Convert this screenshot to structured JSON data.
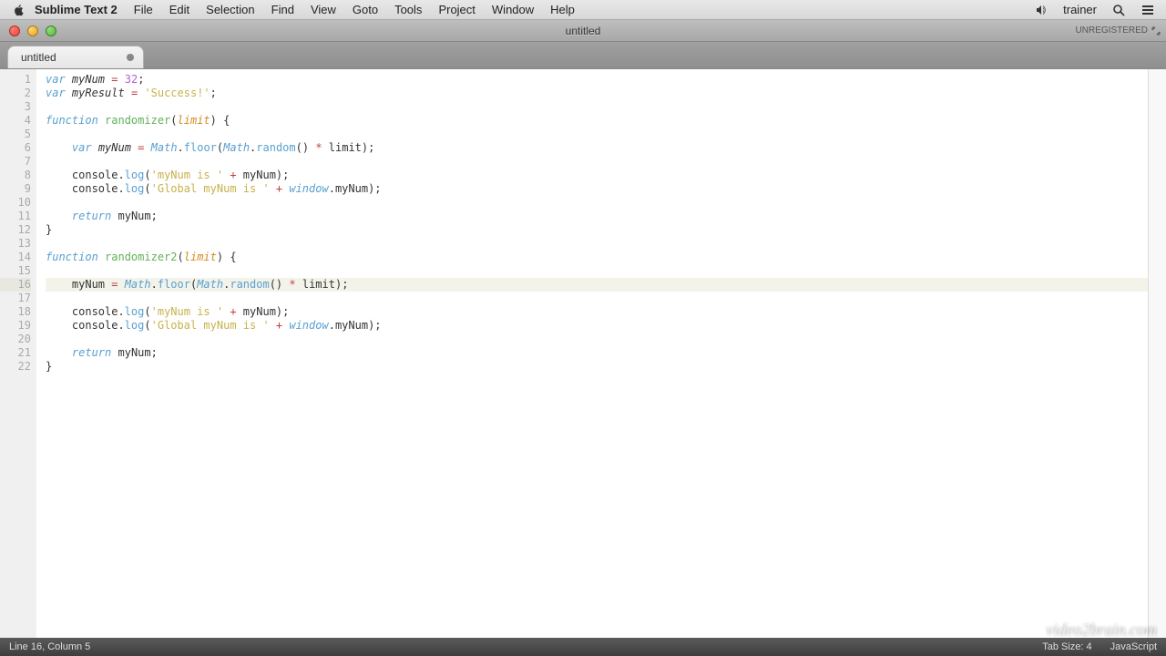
{
  "menubar": {
    "app_name": "Sublime Text 2",
    "items": [
      "File",
      "Edit",
      "Selection",
      "Find",
      "View",
      "Goto",
      "Tools",
      "Project",
      "Window",
      "Help"
    ],
    "user": "trainer"
  },
  "window": {
    "title": "untitled",
    "badge": "UNREGISTERED"
  },
  "tabs": [
    {
      "label": "untitled",
      "dirty": true
    }
  ],
  "editor": {
    "highlighted_line": 16,
    "line_count": 22,
    "code_tokens": [
      [
        [
          "kw",
          "var"
        ],
        [
          "decl",
          " myNum"
        ],
        [
          "op",
          " = "
        ],
        [
          "num",
          "32"
        ],
        [
          "punc",
          ";"
        ]
      ],
      [
        [
          "kw",
          "var"
        ],
        [
          "decl",
          " myResult"
        ],
        [
          "op",
          " = "
        ],
        [
          "str",
          "'Success!'"
        ],
        [
          "punc",
          ";"
        ]
      ],
      [],
      [
        [
          "kw",
          "function"
        ],
        [
          "punc",
          " "
        ],
        [
          "fname",
          "randomizer"
        ],
        [
          "punc",
          "("
        ],
        [
          "param",
          "limit"
        ],
        [
          "punc",
          ") {"
        ]
      ],
      [],
      [
        [
          "punc",
          "    "
        ],
        [
          "kw",
          "var"
        ],
        [
          "decl",
          " myNum"
        ],
        [
          "op",
          " = "
        ],
        [
          "cls",
          "Math"
        ],
        [
          "punc",
          "."
        ],
        [
          "method",
          "floor"
        ],
        [
          "punc",
          "("
        ],
        [
          "cls",
          "Math"
        ],
        [
          "punc",
          "."
        ],
        [
          "method",
          "random"
        ],
        [
          "punc",
          "()"
        ],
        [
          "op",
          " * "
        ],
        [
          "punc",
          "limit);"
        ]
      ],
      [],
      [
        [
          "punc",
          "    console."
        ],
        [
          "method",
          "log"
        ],
        [
          "punc",
          "("
        ],
        [
          "str",
          "'myNum is '"
        ],
        [
          "op",
          " + "
        ],
        [
          "punc",
          "myNum);"
        ]
      ],
      [
        [
          "punc",
          "    console."
        ],
        [
          "method",
          "log"
        ],
        [
          "punc",
          "("
        ],
        [
          "str",
          "'Global myNum is '"
        ],
        [
          "op",
          " + "
        ],
        [
          "glob",
          "window"
        ],
        [
          "punc",
          ".myNum);"
        ]
      ],
      [],
      [
        [
          "punc",
          "    "
        ],
        [
          "kw",
          "return"
        ],
        [
          "punc",
          " myNum;"
        ]
      ],
      [
        [
          "punc",
          "}"
        ]
      ],
      [],
      [
        [
          "kw",
          "function"
        ],
        [
          "punc",
          " "
        ],
        [
          "fname",
          "randomizer2"
        ],
        [
          "punc",
          "("
        ],
        [
          "param",
          "limit"
        ],
        [
          "punc",
          ") {"
        ]
      ],
      [],
      [
        [
          "punc",
          "    myNum "
        ],
        [
          "op",
          "= "
        ],
        [
          "cls",
          "Math"
        ],
        [
          "punc",
          "."
        ],
        [
          "method",
          "floor"
        ],
        [
          "punc",
          "("
        ],
        [
          "cls",
          "Math"
        ],
        [
          "punc",
          "."
        ],
        [
          "method",
          "random"
        ],
        [
          "punc",
          "()"
        ],
        [
          "op",
          " * "
        ],
        [
          "punc",
          "limit);"
        ]
      ],
      [],
      [
        [
          "punc",
          "    console."
        ],
        [
          "method",
          "log"
        ],
        [
          "punc",
          "("
        ],
        [
          "str",
          "'myNum is '"
        ],
        [
          "op",
          " + "
        ],
        [
          "punc",
          "myNum);"
        ]
      ],
      [
        [
          "punc",
          "    console."
        ],
        [
          "method",
          "log"
        ],
        [
          "punc",
          "("
        ],
        [
          "str",
          "'Global myNum is '"
        ],
        [
          "op",
          " + "
        ],
        [
          "glob",
          "window"
        ],
        [
          "punc",
          ".myNum);"
        ]
      ],
      [],
      [
        [
          "punc",
          "    "
        ],
        [
          "kw",
          "return"
        ],
        [
          "punc",
          " myNum;"
        ]
      ],
      [
        [
          "punc",
          "}"
        ]
      ]
    ]
  },
  "statusbar": {
    "left": "Line 16, Column 5",
    "tab_size": "Tab Size: 4",
    "syntax": "JavaScript"
  },
  "watermark": "video2brain.com"
}
